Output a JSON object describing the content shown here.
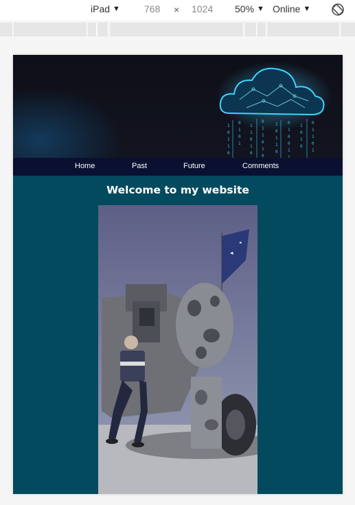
{
  "devtools": {
    "device": "iPad",
    "width": "768",
    "times": "×",
    "height": "1024",
    "zoom": "50%",
    "network": "Online"
  },
  "site": {
    "nav": [
      "Home",
      "Past",
      "Future",
      "Comments"
    ],
    "welcome": "Welcome to my website"
  },
  "colors": {
    "content_bg": "#044a5e",
    "nav_bg": "#0a1130",
    "hero_bg": "#121420",
    "cloud_accent": "#3fd3ff"
  },
  "icons": {
    "dropdown": "caret-down-icon",
    "rotate": "rotate-icon",
    "hero": "digital-cloud-icon"
  }
}
